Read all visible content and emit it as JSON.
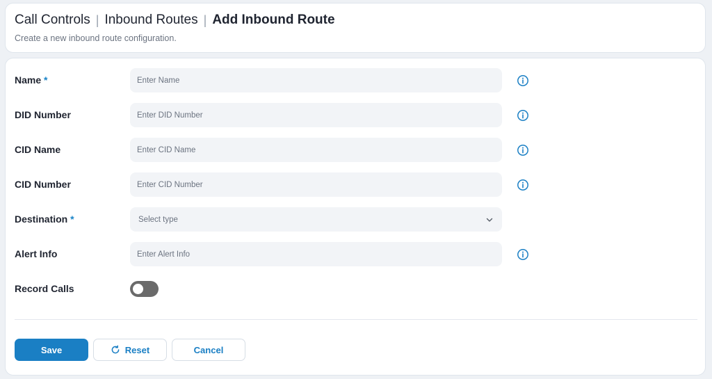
{
  "header": {
    "breadcrumb": [
      "Call Controls",
      "Inbound Routes",
      "Add Inbound Route"
    ],
    "subtitle": "Create a new inbound route configuration."
  },
  "form": {
    "fields": {
      "name": {
        "label": "Name",
        "required": "*",
        "placeholder": "Enter Name",
        "value": ""
      },
      "did_number": {
        "label": "DID Number",
        "placeholder": "Enter DID Number",
        "value": ""
      },
      "cid_name": {
        "label": "CID Name",
        "placeholder": "Enter CID Name",
        "value": ""
      },
      "cid_number": {
        "label": "CID Number",
        "placeholder": "Enter CID Number",
        "value": ""
      },
      "destination": {
        "label": "Destination",
        "required": "*",
        "selected": "Select type"
      },
      "alert_info": {
        "label": "Alert Info",
        "placeholder": "Enter Alert Info",
        "value": ""
      },
      "record_calls": {
        "label": "Record Calls",
        "enabled": false
      }
    },
    "icons": {
      "info": "info-icon",
      "chevron": "chevron-down-icon",
      "reset": "refresh-icon"
    }
  },
  "actions": {
    "save_label": "Save",
    "reset_label": "Reset",
    "cancel_label": "Cancel"
  },
  "colors": {
    "accent": "#1a7fc4",
    "toggle_off": "#6a6a6a",
    "field_bg": "#f2f4f7"
  }
}
